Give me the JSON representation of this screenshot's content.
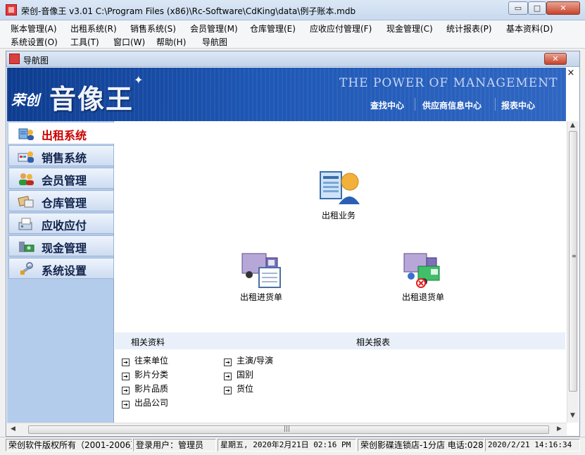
{
  "window": {
    "title": "荣创-音像王 v3.01 C:\\Program Files (x86)\\Rc-Software\\CdKing\\data\\例子账本.mdb",
    "minimize": "▭",
    "maximize": "□",
    "close": "✕"
  },
  "menu": {
    "row1": [
      "账本管理(A)",
      "出租系统(R)",
      "销售系统(S)",
      "会员管理(M)",
      "仓库管理(E)",
      "应收应付管理(F)",
      "现金管理(C)",
      "统计报表(P)",
      "基本资料(D)"
    ],
    "row2": [
      "系统设置(O)",
      "工具(T)",
      "窗口(W)",
      "帮助(H)",
      "导航图"
    ]
  },
  "child": {
    "title": "导航图",
    "close": "✕"
  },
  "banner": {
    "brand_small": "荣创",
    "brand_big": "音像王",
    "slogan": "THE POWER OF MANAGEMENT",
    "links": [
      "查找中心",
      "供应商信息中心",
      "报表中心"
    ],
    "close": "×"
  },
  "nav": {
    "items": [
      {
        "label": "出租系统",
        "icon": "rental-system-icon",
        "active": true
      },
      {
        "label": "销售系统",
        "icon": "sales-system-icon",
        "active": false
      },
      {
        "label": "会员管理",
        "icon": "member-icon",
        "active": false
      },
      {
        "label": "仓库管理",
        "icon": "warehouse-icon",
        "active": false
      },
      {
        "label": "应收应付",
        "icon": "receivable-icon",
        "active": false
      },
      {
        "label": "现金管理",
        "icon": "cash-icon",
        "active": false
      },
      {
        "label": "系统设置",
        "icon": "settings-icon",
        "active": false
      }
    ]
  },
  "main": {
    "items": [
      {
        "label": "出租业务",
        "icon": "rental-business-icon"
      },
      {
        "label": "出租进货单",
        "icon": "purchase-truck-icon"
      },
      {
        "label": "出租退货单",
        "icon": "return-truck-icon"
      }
    ],
    "related_data_title": "相关资料",
    "related_reports_title": "相关报表",
    "related_col1": [
      "往来单位",
      "影片分类",
      "影片品质",
      "出品公司"
    ],
    "related_col2": [
      "主演/导演",
      "国别",
      "货位"
    ]
  },
  "scroll": {
    "grip_v": "≡",
    "grip_h": "|||"
  },
  "status": {
    "copyright": "荣创软件版权所有（2001-2006）",
    "user": "登录用户：管理员",
    "date": "星期五, 2020年2月21日 02:16 PM",
    "store": "荣创影碟连锁店-1分店 电话:028",
    "datetime": "2020/2/21 14:16:34"
  },
  "colors": {
    "banner": "#1e57b5",
    "nav_bg": "#b4ccec",
    "active_label": "#cc0000"
  }
}
